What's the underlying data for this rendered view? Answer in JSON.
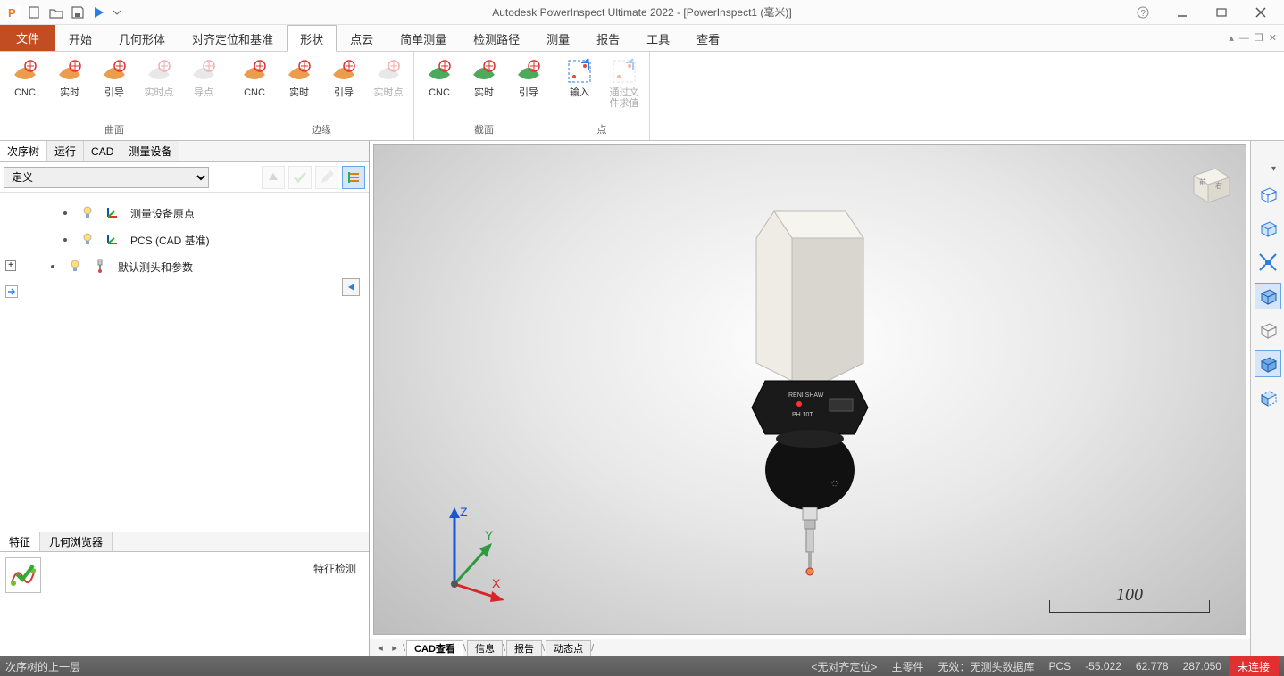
{
  "title": "Autodesk PowerInspect Ultimate 2022 - [PowerInspect1 (毫米)]",
  "menus": {
    "file": "文件",
    "items": [
      "开始",
      "几何形体",
      "对齐定位和基准",
      "形状",
      "点云",
      "简单测量",
      "检测路径",
      "测量",
      "报告",
      "工具",
      "查看"
    ],
    "active_index": 3
  },
  "ribbon": {
    "groups": [
      {
        "label": "曲面",
        "buttons": [
          {
            "l": "CNC",
            "k": "surf"
          },
          {
            "l": "实时",
            "k": "surf"
          },
          {
            "l": "引导",
            "k": "surf"
          },
          {
            "l": "实时点",
            "k": "surf",
            "disabled": true
          },
          {
            "l": "导点",
            "k": "surf",
            "disabled": true
          }
        ]
      },
      {
        "label": "边缘",
        "buttons": [
          {
            "l": "CNC",
            "k": "edge"
          },
          {
            "l": "实时",
            "k": "edge"
          },
          {
            "l": "引导",
            "k": "edge"
          },
          {
            "l": "实时点",
            "k": "edge",
            "disabled": true
          }
        ]
      },
      {
        "label": "截面",
        "buttons": [
          {
            "l": "CNC",
            "k": "sec"
          },
          {
            "l": "实时",
            "k": "sec"
          },
          {
            "l": "引导",
            "k": "sec"
          }
        ]
      },
      {
        "label": "点",
        "buttons": [
          {
            "l": "输入",
            "k": "pt"
          },
          {
            "l": "通过文件求值",
            "k": "pt",
            "disabled": true
          }
        ]
      }
    ]
  },
  "left_tabs": [
    "次序树",
    "运行",
    "CAD",
    "测量设备"
  ],
  "left_active": 0,
  "definition_select": "定义",
  "tree": [
    {
      "label": "测量设备原点",
      "icon": "origin"
    },
    {
      "label": "PCS (CAD 基准)",
      "icon": "origin"
    },
    {
      "label": "默认测头和参数",
      "icon": "probe"
    }
  ],
  "bottom_left_tabs": [
    "特征",
    "几何浏览器"
  ],
  "bottom_left_active": 0,
  "feature_label": "特征检测",
  "view_tabs": [
    "CAD查看",
    "信息",
    "报告",
    "动态点"
  ],
  "view_active": 0,
  "scale_value": "100",
  "status": {
    "left": "次序树的上一层",
    "align": "<无对齐定位>",
    "part": "主零件",
    "invalid": "无效：",
    "db": "无测头数据库",
    "pcs": "PCS",
    "x": "-55.022",
    "y": "62.778",
    "z": "287.050",
    "conn": "未连接"
  },
  "right_tools": [
    {
      "name": "wireframe-icon"
    },
    {
      "name": "shaded-open-icon"
    },
    {
      "name": "fit-icon"
    },
    {
      "name": "iso-box-icon",
      "active": true
    },
    {
      "name": "hidden-line-icon"
    },
    {
      "name": "shaded-solid-icon",
      "active": true
    },
    {
      "name": "section-icon"
    }
  ]
}
